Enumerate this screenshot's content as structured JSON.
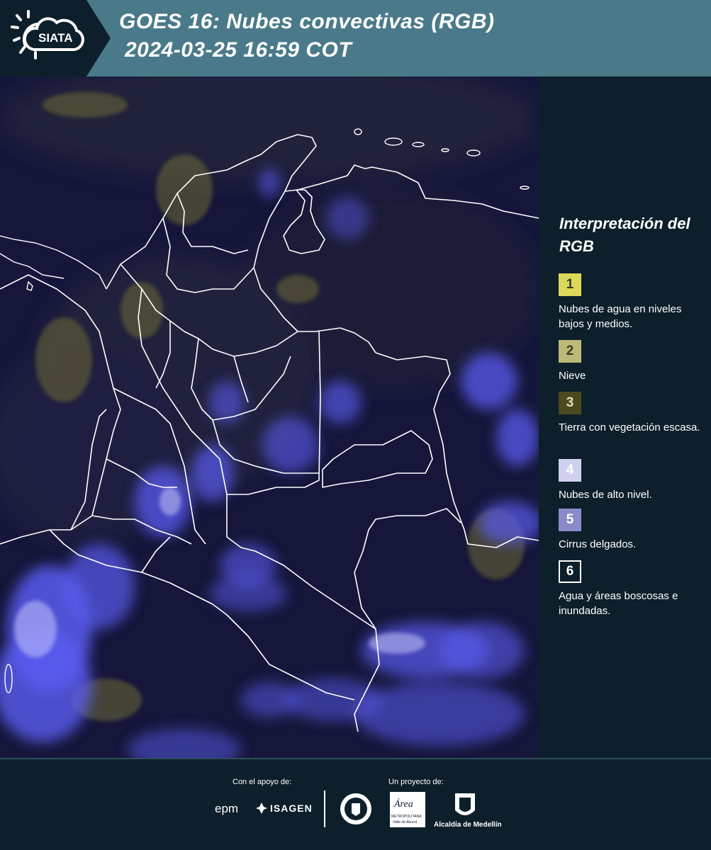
{
  "header": {
    "logo_text": "SIATA",
    "title_line1": "GOES 16: Nubes convectivas (RGB)",
    "title_line2": "2024-03-25 16:59 COT"
  },
  "map": {
    "background_color": "#15163a",
    "cloud_color": "#5a5cf0",
    "border_color": "#ffffff"
  },
  "legend": {
    "title": "Interpretación del RGB",
    "items": [
      {
        "number": "1",
        "label": "Nubes de agua en niveles bajos y medios.",
        "color": "#dcd95a"
      },
      {
        "number": "2",
        "label": "Nieve",
        "color": "#bdb978"
      },
      {
        "number": "3",
        "label": "Tierra con vegetación escasa.",
        "color": "#4b4a1f"
      },
      {
        "number": "4",
        "label": "Nubes de alto nivel.",
        "color": "#cfd0f0"
      },
      {
        "number": "5",
        "label": "Cirrus delgados.",
        "color": "#8b8bcc"
      },
      {
        "number": "6",
        "label": "Agua y áreas boscosas e inundadas.",
        "color": "#0c1f2b"
      }
    ]
  },
  "footer": {
    "support_label": "Con el apoyo de:",
    "project_label": "Un proyecto de:",
    "sponsors": [
      "epm",
      "ISAGEN"
    ],
    "partners": [
      "Área Metropolitana Valle de Aburrá",
      "Alcaldía de Medellín"
    ],
    "area_logo_text": "Área",
    "area_subtitle": "METROPOLITANA",
    "area_subtitle2": "Valle de Aburrá",
    "alcaldia_text": "Alcaldía de Medellín"
  }
}
